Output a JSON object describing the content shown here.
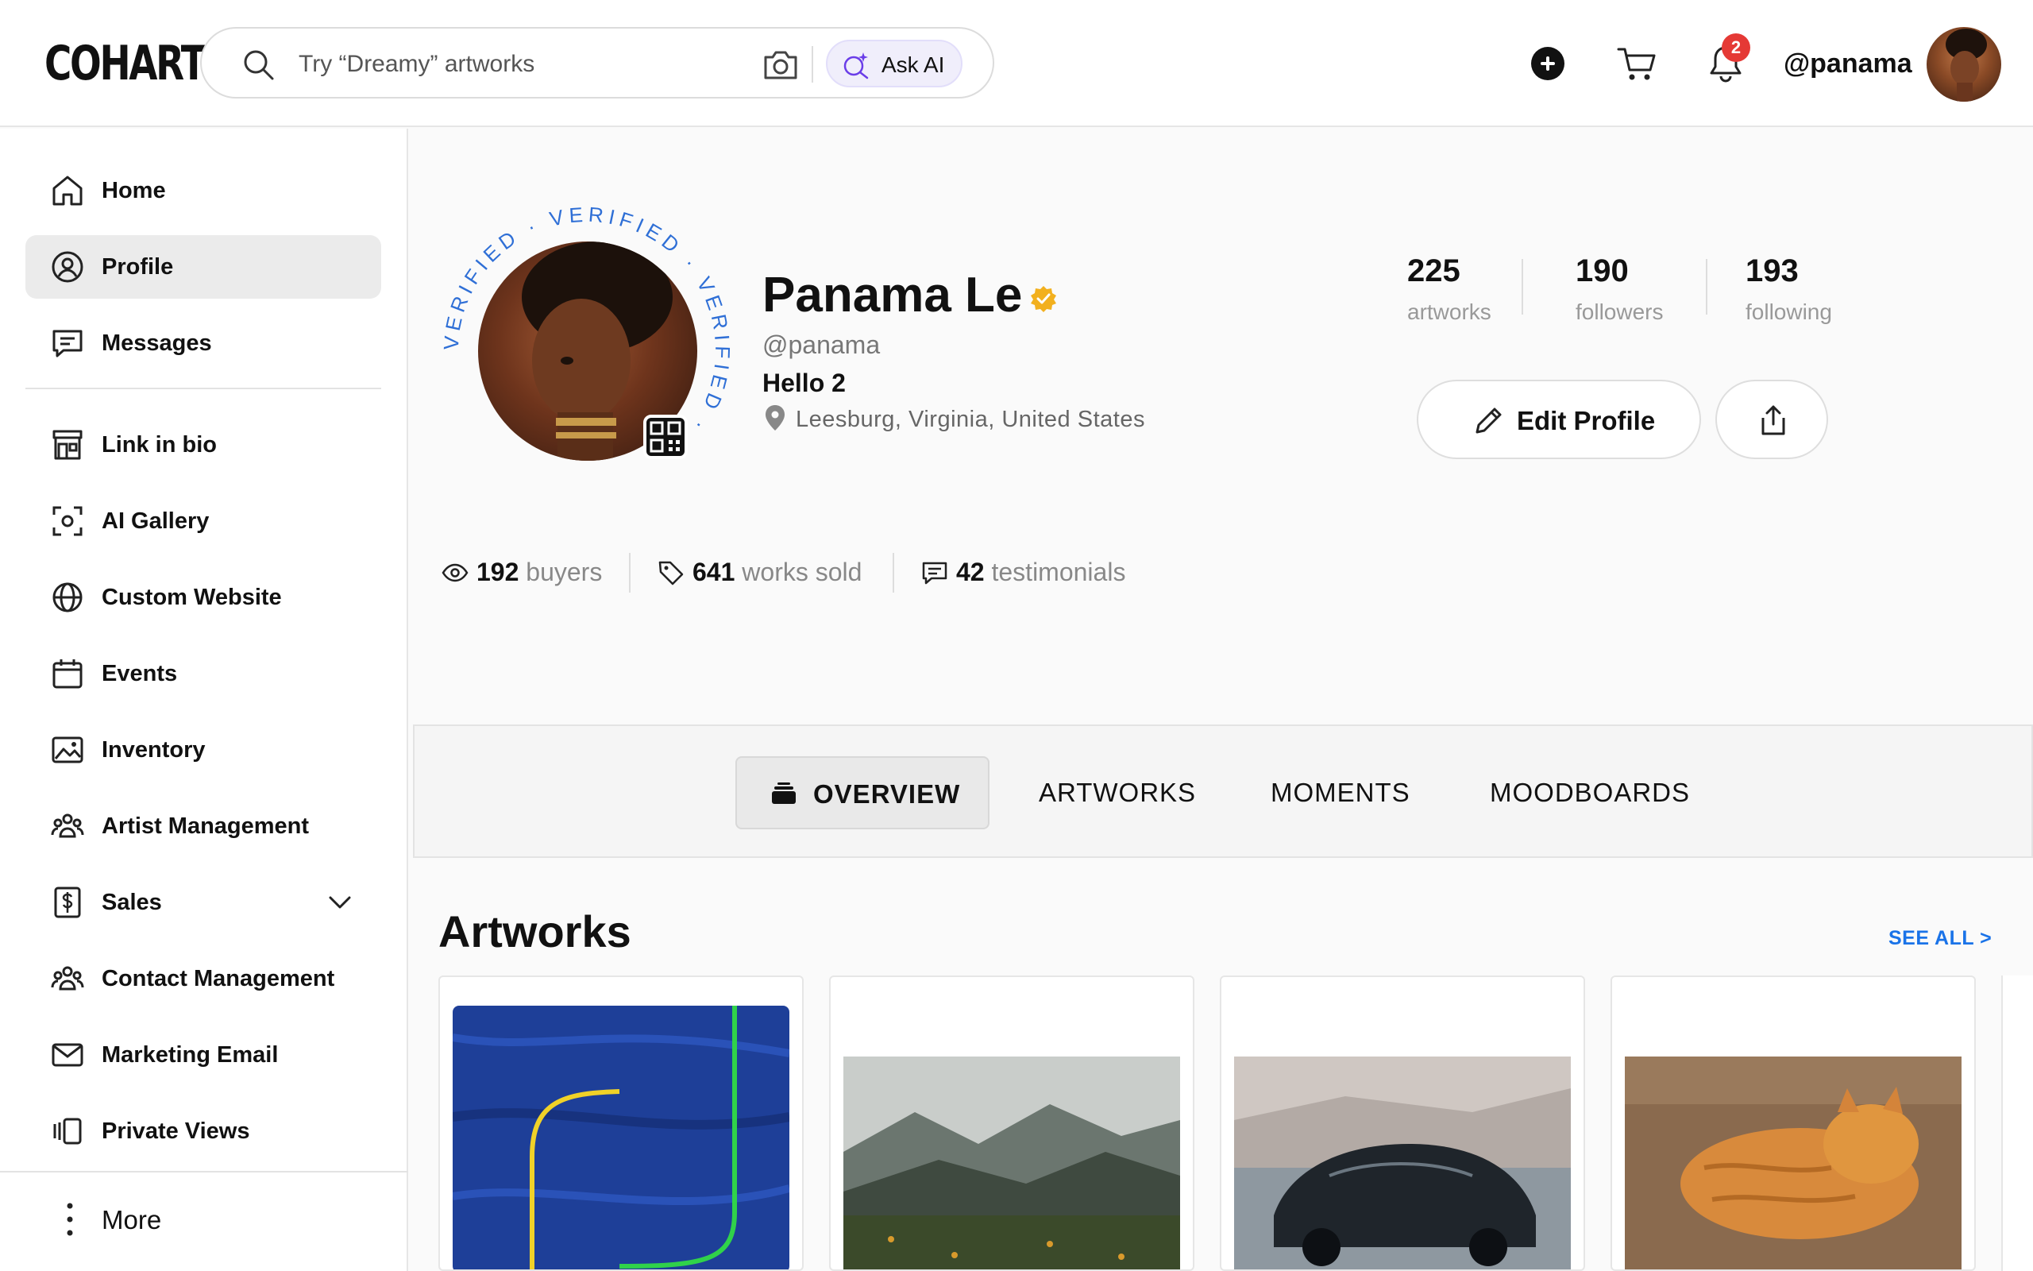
{
  "app": {
    "logo": "COHART"
  },
  "search": {
    "placeholder": "Try “Dreamy” artworks",
    "ask_ai_label": "Ask AI"
  },
  "header": {
    "notification_count": "2",
    "user_handle": "@panama"
  },
  "sidebar": {
    "items": [
      {
        "label": "Home",
        "icon": "home-icon"
      },
      {
        "label": "Profile",
        "icon": "user-circle-icon",
        "active": true
      },
      {
        "label": "Messages",
        "icon": "message-icon"
      },
      {
        "label": "Link in bio",
        "icon": "storefront-icon"
      },
      {
        "label": "AI Gallery",
        "icon": "scan-face-icon"
      },
      {
        "label": "Custom Website",
        "icon": "globe-icon"
      },
      {
        "label": "Events",
        "icon": "calendar-icon"
      },
      {
        "label": "Inventory",
        "icon": "image-icon"
      },
      {
        "label": "Artist Management",
        "icon": "users-icon"
      },
      {
        "label": "Sales",
        "icon": "dollar-receipt-icon",
        "expandable": true
      },
      {
        "label": "Contact Management",
        "icon": "users-icon"
      },
      {
        "label": "Marketing Email",
        "icon": "mail-icon"
      },
      {
        "label": "Private Views",
        "icon": "cards-icon"
      }
    ],
    "more_label": "More"
  },
  "profile": {
    "name": "Panama Le",
    "handle": "@panama",
    "bio": "Hello 2",
    "location": "Leesburg, Virginia, United States",
    "verified_ring_text": "VERIFIED · VERIFIED · VERIFIED · ",
    "stats": [
      {
        "value": "225",
        "label": "artworks"
      },
      {
        "value": "190",
        "label": "followers"
      },
      {
        "value": "193",
        "label": "following"
      }
    ],
    "edit_label": "Edit Profile",
    "metrics": [
      {
        "value": "192",
        "label": "buyers"
      },
      {
        "value": "641",
        "label": "works sold"
      },
      {
        "value": "42",
        "label": "testimonials"
      }
    ]
  },
  "tabs": [
    {
      "label": "OVERVIEW",
      "active": true
    },
    {
      "label": "ARTWORKS"
    },
    {
      "label": "MOMENTS"
    },
    {
      "label": "MOODBOARDS"
    }
  ],
  "artworks": {
    "title": "Artworks",
    "see_all": "SEE ALL >",
    "items": [
      {
        "subject": "abstract blue painting with yellow and green lines"
      },
      {
        "subject": "misty mountain landscape with wildflowers"
      },
      {
        "subject": "black sports car on reflective floor"
      },
      {
        "subject": "orange tabby cat sleeping on wooden floor"
      }
    ]
  },
  "colors": {
    "accent_blue": "#1a73e8",
    "badge_red": "#e53935",
    "verified_gold": "#f2b01e",
    "ring_blue": "#2f6fd6"
  }
}
